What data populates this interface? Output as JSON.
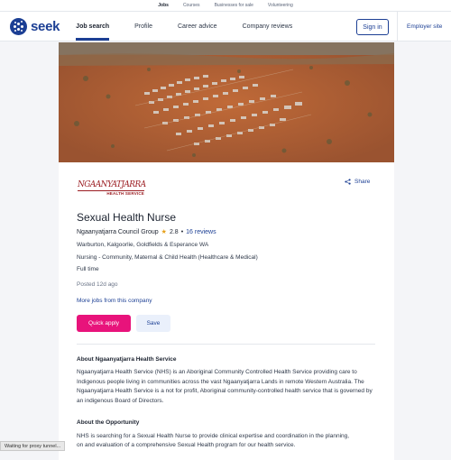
{
  "topbar": {
    "items": [
      "Jobs",
      "Courses",
      "Businesses for sale",
      "Volunteering"
    ]
  },
  "brand": {
    "name": "seek",
    "color": "#1c3f94"
  },
  "nav": {
    "links": [
      "Job search",
      "Profile",
      "Career advice",
      "Company reviews"
    ],
    "signin": "Sign in",
    "employer": "Employer site"
  },
  "job": {
    "company_logo_name": "NGAANYATJARRA",
    "company_logo_sub": "HEALTH SERVICE",
    "share": "Share",
    "title": "Sexual Health Nurse",
    "company": "Ngaanyatjarra Council Group",
    "rating": "2.8",
    "reviews": "16 reviews",
    "location": "Warburton, Kalgoorlie, Goldfields & Esperance WA",
    "category": "Nursing - Community, Maternal & Child Health (Healthcare & Medical)",
    "work_type": "Full time",
    "posted": "Posted 12d ago",
    "more_jobs": "More jobs from this company",
    "apply": "Quick apply",
    "save": "Save"
  },
  "description": {
    "about_heading": "About Ngaanyatjarra Health Service",
    "about_text": "Ngaanyatjarra Health Service (NHS) is an Aboriginal Community Controlled Health Service providing care to Indigenous people living in communities across the vast Ngaanyatjarra Lands in remote Western Australia. The Ngaanyatjarra Health Service is a not for profit, Aboriginal community-controlled health service that is governed by an indigenous Board of Directors.",
    "opportunity_heading": "About the Opportunity",
    "opportunity_line1": "NHS is searching for a Sexual Health Nurse to provide clinical expertise and coordination in the planning,",
    "opportunity_line2": "on and evaluation of a comprehensive Sexual Health program for our health service."
  },
  "status_bar": "Waiting for proxy tunnel..."
}
